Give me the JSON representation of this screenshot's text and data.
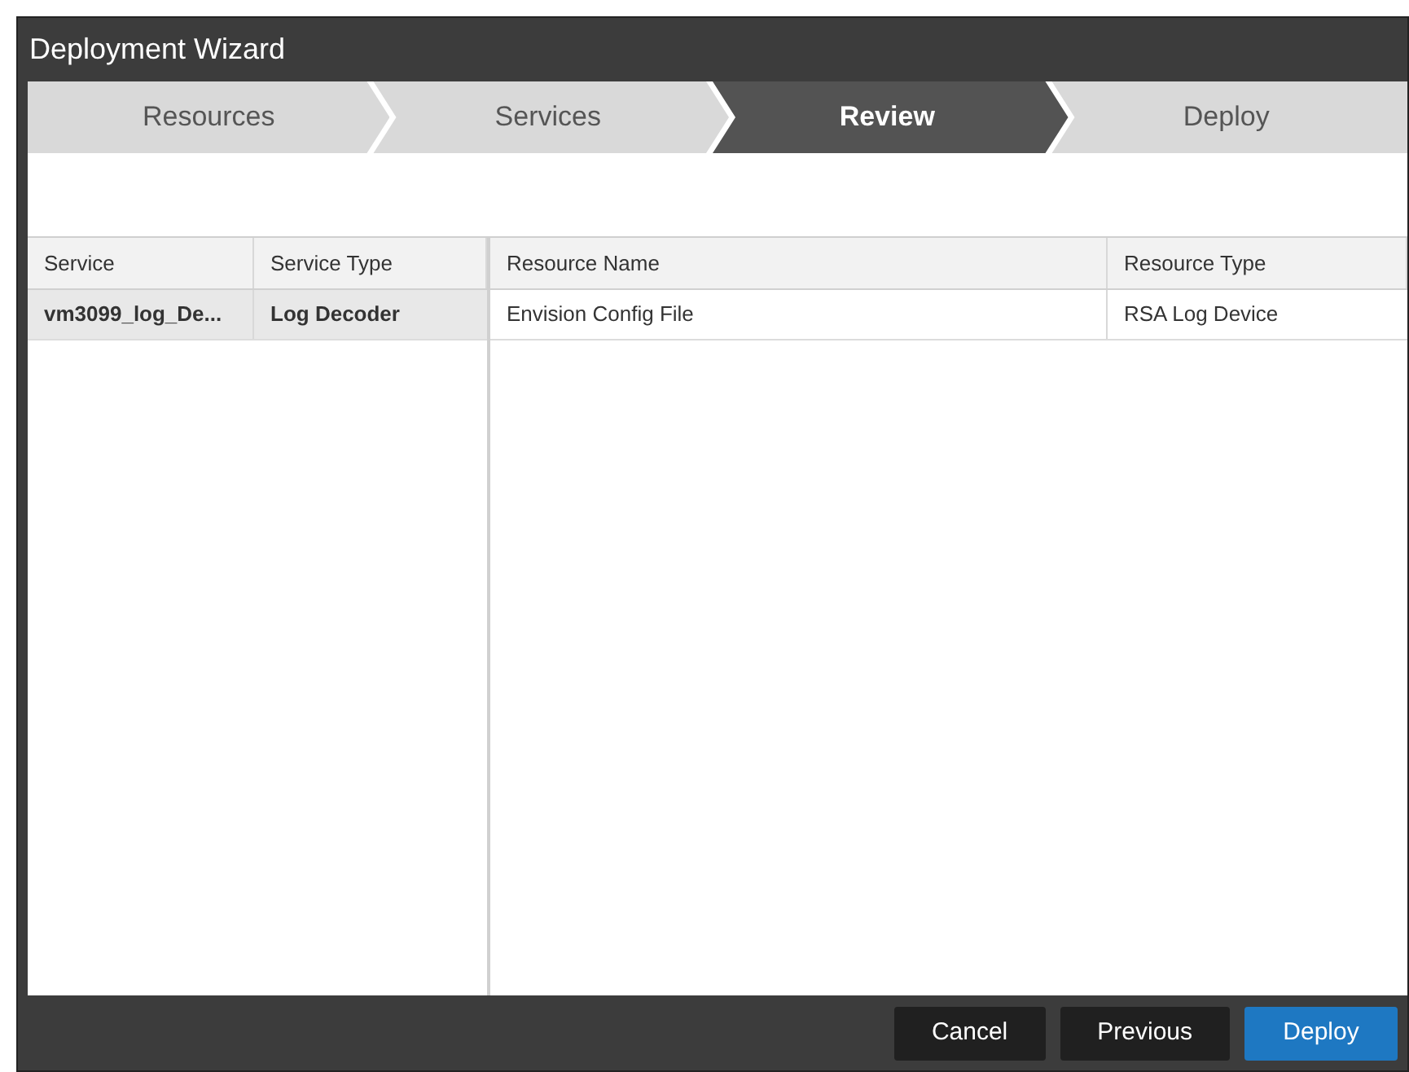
{
  "window": {
    "title": "Deployment Wizard"
  },
  "steps": [
    {
      "label": "Resources",
      "selected": false
    },
    {
      "label": "Services",
      "selected": false
    },
    {
      "label": "Review",
      "selected": true
    },
    {
      "label": "Deploy",
      "selected": false
    }
  ],
  "services_table": {
    "columns": [
      "Service",
      "Service Type"
    ],
    "rows": [
      {
        "cells": [
          "vm3099_log_De...",
          "Log Decoder"
        ],
        "selected": true
      }
    ]
  },
  "resources_table": {
    "columns": [
      "Resource Name",
      "Resource Type"
    ],
    "rows": [
      {
        "cells": [
          "Envision Config File",
          "RSA Log Device"
        ],
        "selected": false
      }
    ]
  },
  "buttons": [
    {
      "label": "Cancel",
      "kind": "secondary"
    },
    {
      "label": "Previous",
      "kind": "secondary"
    },
    {
      "label": "Deploy",
      "kind": "primary"
    }
  ]
}
